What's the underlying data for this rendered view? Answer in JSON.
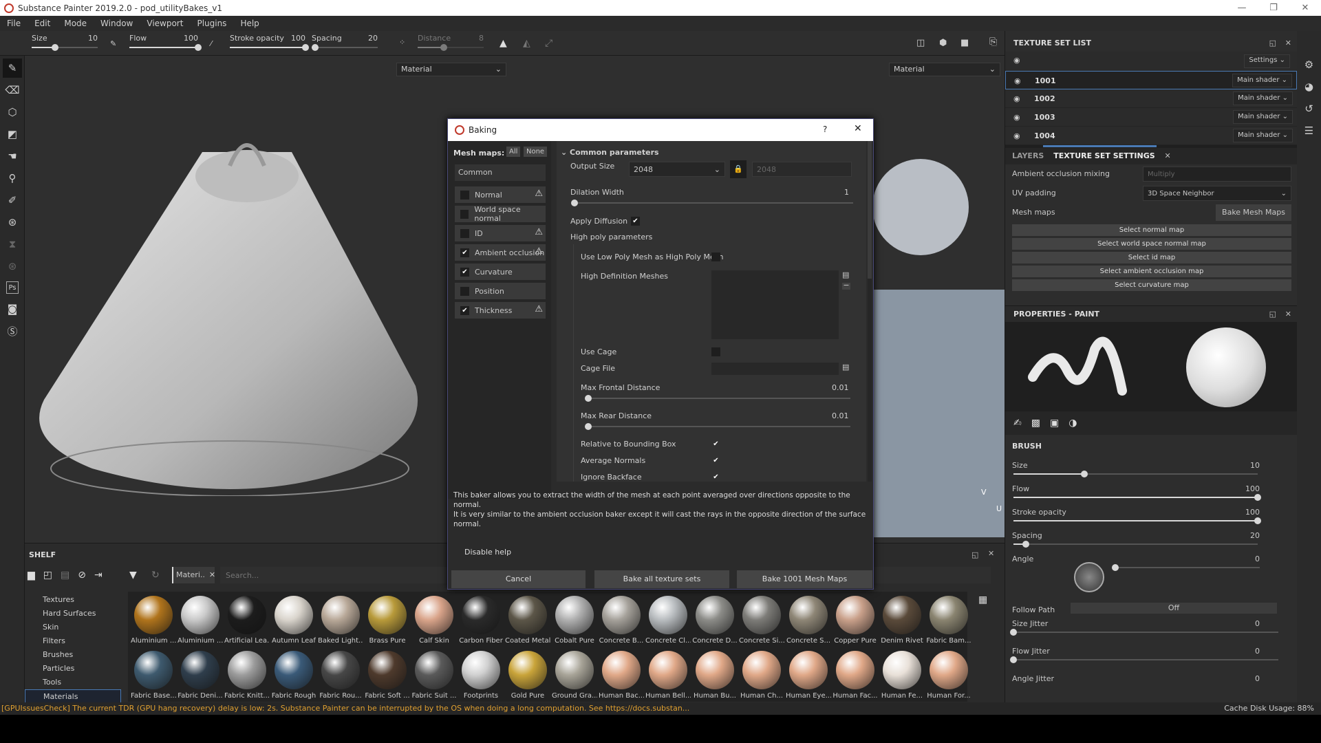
{
  "app": {
    "title": "Substance Painter 2019.2.0 - pod_utilityBakes_v1",
    "window_controls": {
      "minimize": "—",
      "maximize": "❐",
      "close": "✕"
    }
  },
  "menu": [
    "File",
    "Edit",
    "Mode",
    "Window",
    "Viewport",
    "Plugins",
    "Help"
  ],
  "toolbar": {
    "size": {
      "label": "Size",
      "value": "10",
      "fraction": 0.35
    },
    "flow": {
      "label": "Flow",
      "value": "100",
      "fraction": 1.0
    },
    "stroke_opacity": {
      "label": "Stroke opacity",
      "value": "100",
      "fraction": 1.0
    },
    "spacing": {
      "label": "Spacing",
      "value": "20",
      "fraction": 0.05
    },
    "distance": {
      "label": "Distance",
      "value": "8",
      "fraction": 0.4
    }
  },
  "viewport": {
    "left_mode": "Material",
    "right_mode": "Material",
    "axis_v": "V",
    "axis_u": "U"
  },
  "dialog": {
    "title": "Baking",
    "help": "?",
    "close": "✕",
    "mesh_maps_label": "Mesh maps:",
    "all_btn": "All",
    "none_btn": "None",
    "common": "Common",
    "maps": [
      {
        "label": "Normal",
        "checked": false,
        "warning": true
      },
      {
        "label": "World space normal",
        "checked": false,
        "warning": false
      },
      {
        "label": "ID",
        "checked": false,
        "warning": true
      },
      {
        "label": "Ambient occlusion",
        "checked": true,
        "warning": true
      },
      {
        "label": "Curvature",
        "checked": true,
        "warning": false
      },
      {
        "label": "Position",
        "checked": false,
        "warning": false
      },
      {
        "label": "Thickness",
        "checked": true,
        "warning": true
      }
    ],
    "section": "Common parameters",
    "output_size_label": "Output Size",
    "output_size": "2048",
    "output_size_locked": "2048",
    "dilation_label": "Dilation Width",
    "dilation_value": "1",
    "dilation_fraction": 0.0,
    "apply_diffusion_label": "Apply Diffusion",
    "apply_diffusion": true,
    "high_poly_label": "High poly parameters",
    "use_low_poly_label": "Use Low Poly Mesh as High Poly Mesh",
    "use_low_poly": false,
    "hd_meshes_label": "High Definition Meshes",
    "use_cage_label": "Use Cage",
    "use_cage": false,
    "cage_file_label": "Cage File",
    "max_frontal_label": "Max Frontal Distance",
    "max_frontal_value": "0.01",
    "max_frontal_fraction": 0.01,
    "max_rear_label": "Max Rear Distance",
    "max_rear_value": "0.01",
    "max_rear_fraction": 0.01,
    "relative_bbox_label": "Relative to Bounding Box",
    "relative_bbox": true,
    "average_normals_label": "Average Normals",
    "average_normals": true,
    "ignore_backface_label": "Ignore Backface",
    "ignore_backface": true,
    "help_text_1": "This baker allows you to extract the width of the mesh at each point averaged over directions opposite to the normal.",
    "help_text_2": "It is very similar to the ambient occlusion baker except it will cast the rays in the opposite direction of the surface normal.",
    "disable_help": "Disable help",
    "cancel": "Cancel",
    "bake_all": "Bake all texture sets",
    "bake_one": "Bake 1001 Mesh Maps"
  },
  "texture_set_list": {
    "title": "TEXTURE SET LIST",
    "settings": "Settings",
    "sets": [
      {
        "id": "1001",
        "shader": "Main shader",
        "selected": true
      },
      {
        "id": "1002",
        "shader": "Main shader",
        "selected": false
      },
      {
        "id": "1003",
        "shader": "Main shader",
        "selected": false
      },
      {
        "id": "1004",
        "shader": "Main shader",
        "selected": false
      }
    ]
  },
  "tabs": {
    "layers": "LAYERS",
    "tss": "TEXTURE SET SETTINGS"
  },
  "tss": {
    "ao_mixing_label": "Ambient occlusion mixing",
    "ao_mixing_value": "Multiply",
    "uv_padding_label": "UV padding",
    "uv_padding_value": "3D Space Neighbor",
    "mesh_maps_label": "Mesh maps",
    "bake_btn": "Bake Mesh Maps",
    "select_buttons": [
      "Select normal map",
      "Select world space normal map",
      "Select id map",
      "Select ambient occlusion map",
      "Select curvature map"
    ]
  },
  "properties": {
    "title": "PROPERTIES - PAINT",
    "brush_header": "BRUSH",
    "size": {
      "label": "Size",
      "value": "10",
      "fraction": 0.29
    },
    "flow": {
      "label": "Flow",
      "value": "100",
      "fraction": 1.0
    },
    "stroke_opacity": {
      "label": "Stroke opacity",
      "value": "100",
      "fraction": 1.0
    },
    "spacing": {
      "label": "Spacing",
      "value": "20",
      "fraction": 0.05
    },
    "angle": {
      "label": "Angle",
      "value": "0",
      "fraction": 0.0
    },
    "follow_path": {
      "label": "Follow Path",
      "value": "Off"
    },
    "size_jitter": {
      "label": "Size Jitter",
      "value": "0",
      "fraction": 0.0
    },
    "flow_jitter": {
      "label": "Flow Jitter",
      "value": "0",
      "fraction": 0.0
    },
    "angle_jitter": {
      "label": "Angle Jitter",
      "value": "0"
    }
  },
  "shelf": {
    "title": "SHELF",
    "filter_tag": "Materi..",
    "search_placeholder": "Search...",
    "categories": [
      "Textures",
      "Hard Surfaces",
      "Skin",
      "Filters",
      "Brushes",
      "Particles",
      "Tools",
      "Materials"
    ],
    "selected_category": "Materials",
    "materials_row1": [
      {
        "name": "Aluminium ...",
        "color": "#b0741c"
      },
      {
        "name": "Aluminium ...",
        "color": "#c9c9c9"
      },
      {
        "name": "Artificial Lea...",
        "color": "#1c1c1c"
      },
      {
        "name": "Autumn Leaf",
        "color": "#d9d4cc"
      },
      {
        "name": "Baked Light...",
        "color": "#b8a898"
      },
      {
        "name": "Brass Pure",
        "color": "#b89a3a"
      },
      {
        "name": "Calf Skin",
        "color": "#d9a48a"
      },
      {
        "name": "Carbon Fiber",
        "color": "#2a2a2a"
      },
      {
        "name": "Coated Metal",
        "color": "#5c5648"
      },
      {
        "name": "Cobalt Pure",
        "color": "#b0b0b0"
      },
      {
        "name": "Concrete B...",
        "color": "#a5a19a"
      },
      {
        "name": "Concrete Cl...",
        "color": "#b8bcbf"
      },
      {
        "name": "Concrete D...",
        "color": "#8c8c88"
      },
      {
        "name": "Concrete Si...",
        "color": "#7d7c78"
      },
      {
        "name": "Concrete S...",
        "color": "#8e8676"
      },
      {
        "name": "Copper Pure",
        "color": "#c9a08a"
      },
      {
        "name": "Denim Rivet",
        "color": "#5a4a3a"
      },
      {
        "name": "Fabric Bam...",
        "color": "#8a8470"
      }
    ],
    "materials_row2": [
      {
        "name": "Fabric Base...",
        "color": "#3e5a6e"
      },
      {
        "name": "Fabric Deni...",
        "color": "#2f3e4c"
      },
      {
        "name": "Fabric Knitt...",
        "color": "#9c9c9c"
      },
      {
        "name": "Fabric Rough",
        "color": "#3a5a78"
      },
      {
        "name": "Fabric Rou...",
        "color": "#474747"
      },
      {
        "name": "Fabric Soft ...",
        "color": "#4e3a2c"
      },
      {
        "name": "Fabric Suit ...",
        "color": "#5a5a5a"
      },
      {
        "name": "Footprints",
        "color": "#d0d0d0"
      },
      {
        "name": "Gold Pure",
        "color": "#c9a43a"
      },
      {
        "name": "Ground Gra...",
        "color": "#a8a498"
      },
      {
        "name": "Human Bac...",
        "color": "#e0a888"
      },
      {
        "name": "Human Bell...",
        "color": "#e0a888"
      },
      {
        "name": "Human Bu...",
        "color": "#e0a888"
      },
      {
        "name": "Human Ch...",
        "color": "#e0a888"
      },
      {
        "name": "Human Eye...",
        "color": "#e0a888"
      },
      {
        "name": "Human Fac...",
        "color": "#e0a888"
      },
      {
        "name": "Human Fe...",
        "color": "#e8e0d8"
      },
      {
        "name": "Human For...",
        "color": "#e0a888"
      }
    ]
  },
  "status": {
    "message": "[GPUIssuesCheck] The current TDR (GPU hang recovery) delay is low: 2s. Substance Painter can be interrupted by the OS when doing a long computation. See https://docs.substan...",
    "cache_label": "Cache Disk Usage:",
    "cache_value": "88%"
  },
  "colors": {
    "accent": "#4a7ab5",
    "warning_text": "#e0a030"
  }
}
